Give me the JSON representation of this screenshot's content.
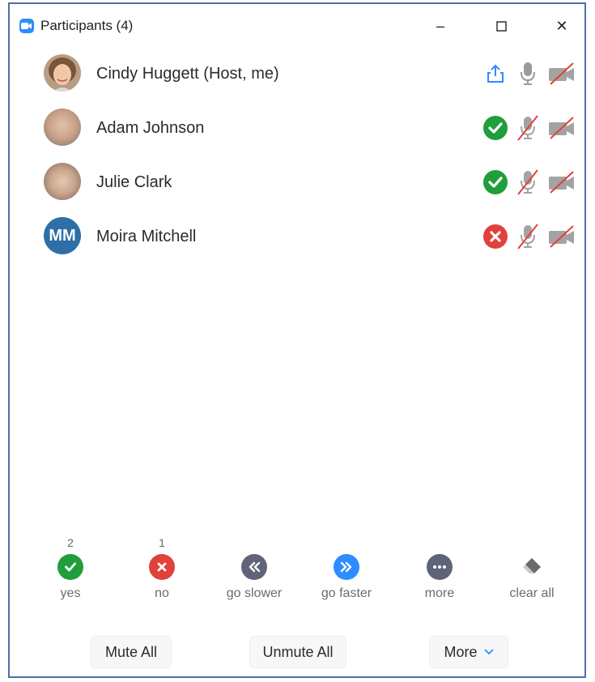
{
  "window": {
    "title": "Participants (4)",
    "min_glyph": "–",
    "max_glyph": "☐",
    "close_glyph": "✕"
  },
  "participants": [
    {
      "name": "Cindy Huggett (Host, me)",
      "avatar": "photo",
      "status": "share-icon",
      "mic": "mic-icon",
      "video": "video-off-icon"
    },
    {
      "name": "Adam Johnson",
      "avatar": "photo",
      "status": "yes-check-icon",
      "mic": "mic-off-icon",
      "video": "video-off-icon"
    },
    {
      "name": "Julie Clark",
      "avatar": "photo",
      "status": "yes-check-icon",
      "mic": "mic-off-icon",
      "video": "video-off-icon"
    },
    {
      "name": "Moira Mitchell",
      "avatar": "initials",
      "initials": "MM",
      "status": "no-x-icon",
      "mic": "mic-off-icon",
      "video": "video-off-icon"
    }
  ],
  "reactions": [
    {
      "id": "yes",
      "count": "2",
      "label": "yes",
      "color": "#1f9e3b"
    },
    {
      "id": "no",
      "count": "1",
      "label": "no",
      "color": "#e0413a"
    },
    {
      "id": "go-slower",
      "count": "",
      "label": "go slower",
      "color": "#5f6478"
    },
    {
      "id": "go-faster",
      "count": "",
      "label": "go faster",
      "color": "#2d8cff"
    },
    {
      "id": "more",
      "count": "",
      "label": "more",
      "color": "#5f6478"
    },
    {
      "id": "clear-all",
      "count": "",
      "label": "clear all",
      "color": "#6b6b6b"
    }
  ],
  "footer": {
    "mute_all": "Mute All",
    "unmute_all": "Unmute All",
    "more": "More"
  },
  "colors": {
    "accent": "#2d8cff",
    "yes": "#1f9e3b",
    "no": "#e0413a",
    "muted_slash": "#e0413a",
    "frame": "#4d6fa8"
  }
}
